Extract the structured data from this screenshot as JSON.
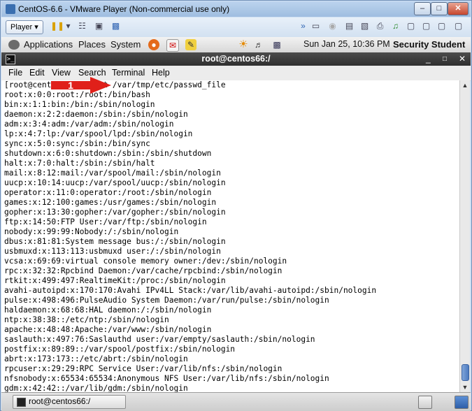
{
  "vmware": {
    "title": "CentOS-6.6 - VMware Player (Non-commercial use only)",
    "player_label": "Player",
    "window_buttons": [
      "minimize",
      "maximize",
      "close"
    ]
  },
  "gnome_panel": {
    "applications": "Applications",
    "places": "Places",
    "system": "System",
    "clock": "Sun Jan 25, 10:36 PM",
    "user": "Security Student"
  },
  "terminal": {
    "title": "root@centos66:/",
    "menu": [
      "File",
      "Edit",
      "View",
      "Search",
      "Terminal",
      "Help"
    ],
    "lines": [
      "[root@centos66 /]# cat /var/tmp/etc/passwd_file",
      "root:x:0:0:root:/root:/bin/bash",
      "bin:x:1:1:bin:/bin:/sbin/nologin",
      "daemon:x:2:2:daemon:/sbin:/sbin/nologin",
      "adm:x:3:4:adm:/var/adm:/sbin/nologin",
      "lp:x:4:7:lp:/var/spool/lpd:/sbin/nologin",
      "sync:x:5:0:sync:/sbin:/bin/sync",
      "shutdown:x:6:0:shutdown:/sbin:/sbin/shutdown",
      "halt:x:7:0:halt:/sbin:/sbin/halt",
      "mail:x:8:12:mail:/var/spool/mail:/sbin/nologin",
      "uucp:x:10:14:uucp:/var/spool/uucp:/sbin/nologin",
      "operator:x:11:0:operator:/root:/sbin/nologin",
      "games:x:12:100:games:/usr/games:/sbin/nologin",
      "gopher:x:13:30:gopher:/var/gopher:/sbin/nologin",
      "ftp:x:14:50:FTP User:/var/ftp:/sbin/nologin",
      "nobody:x:99:99:Nobody:/:/sbin/nologin",
      "dbus:x:81:81:System message bus:/:/sbin/nologin",
      "usbmuxd:x:113:113:usbmuxd user:/:/sbin/nologin",
      "vcsa:x:69:69:virtual console memory owner:/dev:/sbin/nologin",
      "rpc:x:32:32:Rpcbind Daemon:/var/cache/rpcbind:/sbin/nologin",
      "rtkit:x:499:497:RealtimeKit:/proc:/sbin/nologin",
      "avahi-autoipd:x:170:170:Avahi IPv4LL Stack:/var/lib/avahi-autoipd:/sbin/nologin",
      "pulse:x:498:496:PulseAudio System Daemon:/var/run/pulse:/sbin/nologin",
      "haldaemon:x:68:68:HAL daemon:/:/sbin/nologin",
      "ntp:x:38:38::/etc/ntp:/sbin/nologin",
      "apache:x:48:48:Apache:/var/www:/sbin/nologin",
      "saslauth:x:497:76:Saslauthd user:/var/empty/saslauth:/sbin/nologin",
      "postfix:x:89:89::/var/spool/postfix:/sbin/nologin",
      "abrt:x:173:173::/etc/abrt:/sbin/nologin",
      "rpcuser:x:29:29:RPC Service User:/var/lib/nfs:/sbin/nologin",
      "nfsnobody:x:65534:65534:Anonymous NFS User:/var/lib/nfs:/sbin/nologin",
      "gdm:x:42:42::/var/lib/gdm:/sbin/nologin"
    ]
  },
  "callout": {
    "number": "1",
    "color": "#e0201a"
  },
  "taskbar": {
    "item_label": "root@centos66:/"
  }
}
